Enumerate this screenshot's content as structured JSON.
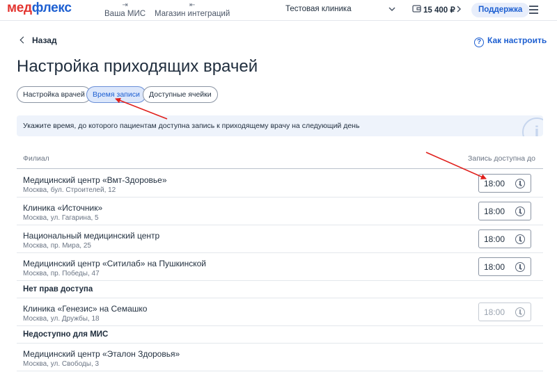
{
  "header": {
    "logo_part1": "мед",
    "logo_part2": "флекс",
    "nav": [
      {
        "label": "Ваша МИС"
      },
      {
        "label": "Магазин интеграций"
      }
    ],
    "clinic": "Тестовая клиника",
    "balance": "15 400 ₽",
    "support": "Поддержка"
  },
  "page": {
    "back": "Назад",
    "help": "Как настроить",
    "title": "Настройка приходящих врачей",
    "tabs": [
      {
        "label": "Настройка врачей",
        "active": false
      },
      {
        "label": "Время записи",
        "active": true
      },
      {
        "label": "Доступные ячейки",
        "active": false
      }
    ],
    "info": "Укажите время, до которого пациентам доступна запись к приходящему врачу на следующий день",
    "info_icon": "i"
  },
  "table": {
    "col_branch": "Филиал",
    "col_time": "Запись доступна до",
    "rows": [
      {
        "name": "Медицинский центр «Вмт-Здоровье»",
        "address": "Москва, бул. Строителей, 12",
        "time": "18:00"
      },
      {
        "name": "Клиника «Источник»",
        "address": "Москва, ул. Гагарина, 5",
        "time": "18:00"
      },
      {
        "name": "Национальный медицинский центр",
        "address": "Москва, пр. Мира, 25",
        "time": "18:00"
      },
      {
        "name": "Медицинский центр «Ситилаб» на Пушкинской",
        "address": "Москва, пр. Победы, 47",
        "time": "18:00"
      }
    ],
    "no_access_title": "Нет прав доступа",
    "no_access_rows": [
      {
        "name": "Клиника «Генезис» на Семашко",
        "address": "Москва, ул. Дружбы, 18",
        "time": "18:00"
      }
    ],
    "unavailable_title": "Недоступно для МИС",
    "unavailable_rows": [
      {
        "name": "Медицинский центр «Эталон Здоровья»",
        "address": "Москва, ул. Свободы, 3"
      }
    ]
  },
  "colors": {
    "brand_red": "#e3342f",
    "brand_blue": "#1d5fd1",
    "annotation_arrow": "#e0201c"
  },
  "icons": [
    "logout-icon",
    "login-icon",
    "chevron-down-icon",
    "wallet-icon",
    "chevron-right-icon",
    "burger-menu-icon",
    "chevron-left-icon",
    "question-icon",
    "info-icon",
    "clock-icon"
  ]
}
